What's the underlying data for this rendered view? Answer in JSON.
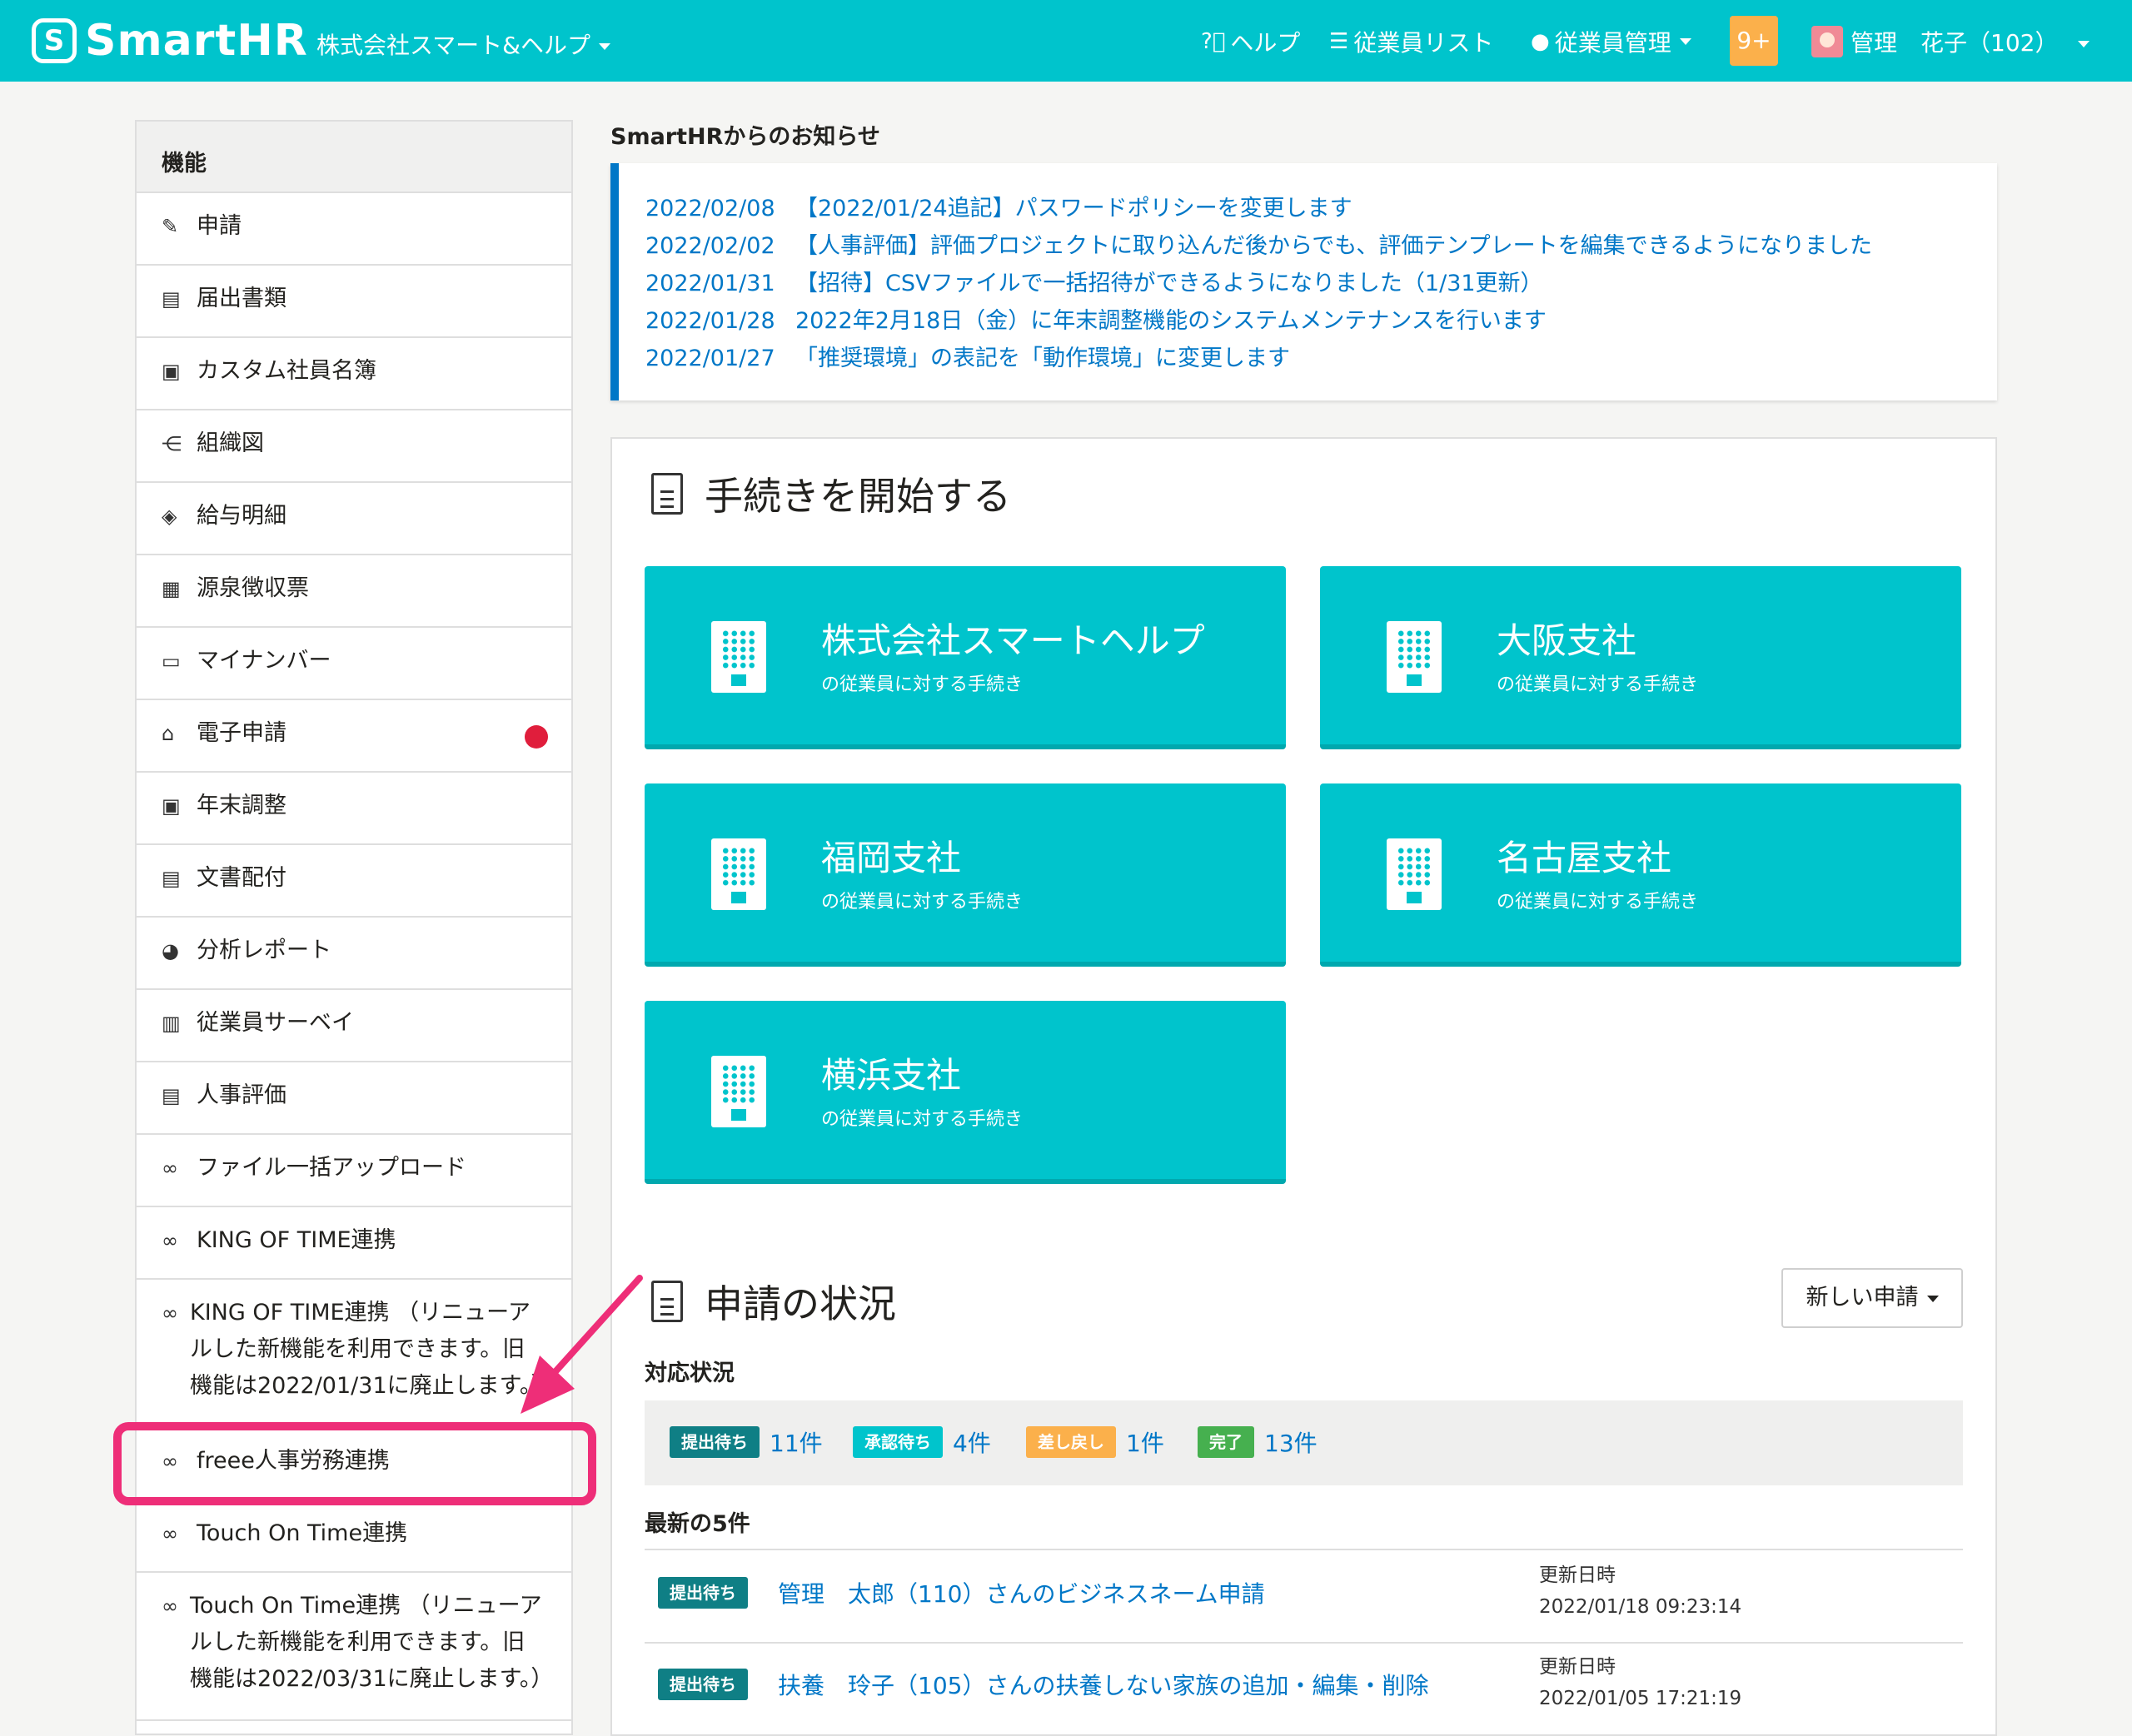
{
  "header": {
    "logo_mark": "S",
    "logo_text": "SmartHR",
    "company": "株式会社スマート&ヘルプ",
    "help": "ヘルプ",
    "employee_list": "従業員リスト",
    "employee_mgmt": "従業員管理",
    "notification_count": "9+",
    "user": "管理　花子（102）"
  },
  "sidebar": {
    "title": "機能",
    "items": [
      {
        "icon": "application-icon",
        "glyph": "✎",
        "label": "申請"
      },
      {
        "icon": "document-icon",
        "glyph": "▤",
        "label": "届出書類"
      },
      {
        "icon": "employee-book-icon",
        "glyph": "▣",
        "label": "カスタム社員名簿"
      },
      {
        "icon": "org-chart-icon",
        "glyph": "⋲",
        "label": "組織図"
      },
      {
        "icon": "payslip-icon",
        "glyph": "◈",
        "label": "給与明細"
      },
      {
        "icon": "calculator-icon",
        "glyph": "▦",
        "label": "源泉徴収票"
      },
      {
        "icon": "id-card-icon",
        "glyph": "▭",
        "label": "マイナンバー"
      },
      {
        "icon": "bank-icon",
        "glyph": "⌂",
        "label": "電子申請"
      },
      {
        "icon": "calendar-icon",
        "glyph": "▣",
        "label": "年末調整"
      },
      {
        "icon": "inbox-icon",
        "glyph": "▤",
        "label": "文書配付"
      },
      {
        "icon": "pie-chart-icon",
        "glyph": "◕",
        "label": "分析レポート"
      },
      {
        "icon": "clipboard-icon",
        "glyph": "▥",
        "label": "従業員サーベイ"
      },
      {
        "icon": "evaluation-icon",
        "glyph": "▤",
        "label": "人事評価"
      },
      {
        "icon": "link-icon",
        "glyph": "∞",
        "label": "ファイル一括アップロード"
      },
      {
        "icon": "link-icon",
        "glyph": "∞",
        "label": "KING OF TIME連携"
      },
      {
        "icon": "link-icon",
        "glyph": "∞",
        "label": "KING OF TIME連携 （リニューアルした新機能を利用できます。旧機能は2022/01/31に廃止します。）"
      },
      {
        "icon": "link-icon",
        "glyph": "∞",
        "label": "freee人事労務連携"
      },
      {
        "icon": "link-icon",
        "glyph": "∞",
        "label": "Touch On Time連携"
      },
      {
        "icon": "link-icon",
        "glyph": "∞",
        "label": "Touch On Time連携 （リニューアルした新機能を利用できます。旧機能は2022/03/31に廃止します。）"
      }
    ]
  },
  "notices": {
    "title": "SmartHRからのお知らせ",
    "items": [
      {
        "date": "2022/02/08",
        "text": "【2022/01/24追記】パスワードポリシーを変更します"
      },
      {
        "date": "2022/02/02",
        "text": "【人事評価】評価プロジェクトに取り込んだ後からでも、評価テンプレートを編集できるようになりました"
      },
      {
        "date": "2022/01/31",
        "text": "【招待】CSVファイルで一括招待ができるようになりました（1/31更新）"
      },
      {
        "date": "2022/01/28",
        "text": "2022年2月18日（金）に年末調整機能のシステムメンテナンスを行います"
      },
      {
        "date": "2022/01/27",
        "text": "「推奨環境」の表記を「動作環境」に変更します"
      }
    ]
  },
  "procedures": {
    "title": "手続きを開始する",
    "tiles": [
      {
        "name": "株式会社スマートヘルプ",
        "sub": "の従業員に対する手続き"
      },
      {
        "name": "大阪支社",
        "sub": "の従業員に対する手続き"
      },
      {
        "name": "福岡支社",
        "sub": "の従業員に対する手続き"
      },
      {
        "name": "名古屋支社",
        "sub": "の従業員に対する手続き"
      },
      {
        "name": "横浜支社",
        "sub": "の従業員に対する手続き"
      }
    ]
  },
  "applications": {
    "title": "申請の状況",
    "new_button": "新しい申請",
    "status_heading": "対応状況",
    "statuses": [
      {
        "tag": "提出待ち",
        "count": "11件",
        "color": "#0f7f85"
      },
      {
        "tag": "承認待ち",
        "count": "4件",
        "color": "#00c4cc"
      },
      {
        "tag": "差し戻し",
        "count": "1件",
        "color": "#fbb04b"
      },
      {
        "tag": "完了",
        "count": "13件",
        "color": "#46b04f"
      }
    ],
    "latest_heading": "最新の5件",
    "rows": [
      {
        "tag": "提出待ち",
        "text": "管理　太郎（110）さんのビジネスネーム申請",
        "meta_label": "更新日時",
        "meta_value": "2022/01/18 09:23:14"
      },
      {
        "tag": "提出待ち",
        "text": "扶養　玲子（105）さんの扶養しない家族の追加・編集・削除",
        "meta_label": "更新日時",
        "meta_value": "2022/01/05 17:21:19"
      }
    ]
  },
  "colors": {
    "brand": "#00c4cc",
    "link": "#0077c7",
    "annotation": "#ee2e78",
    "alert": "#e01e3c"
  }
}
